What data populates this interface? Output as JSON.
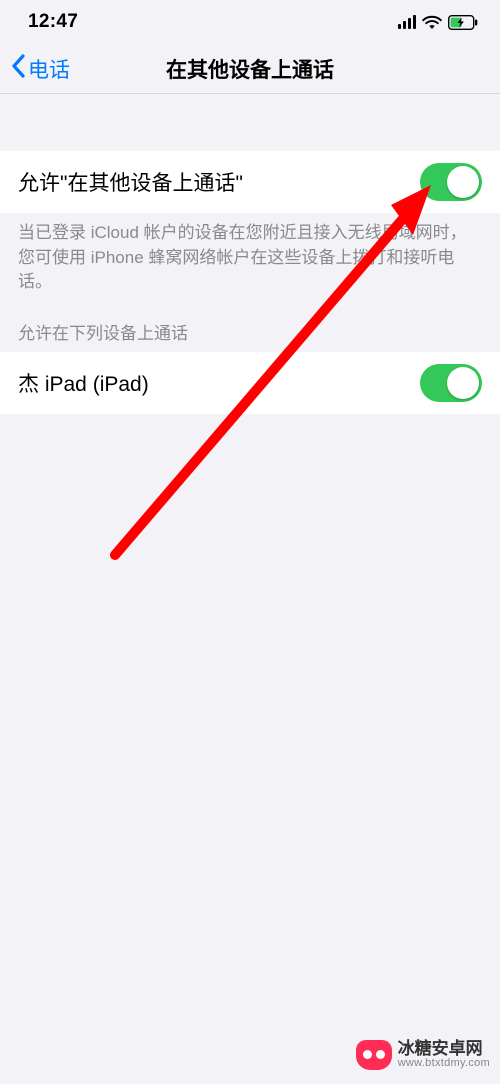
{
  "status": {
    "time": "12:47"
  },
  "nav": {
    "back_label": "电话",
    "title": "在其他设备上通话"
  },
  "main_toggle": {
    "label": "允许\"在其他设备上通话\"",
    "on": true
  },
  "footer": "当已登录 iCloud 帐户的设备在您附近且接入无线局域网时，您可使用 iPhone 蜂窝网络帐户在这些设备上拨打和接听电话。",
  "devices_header": "允许在下列设备上通话",
  "devices": [
    {
      "label": "杰 iPad (iPad)",
      "on": true
    }
  ],
  "watermark": {
    "name": "冰糖安卓网",
    "url": "www.btxtdmy.com"
  }
}
